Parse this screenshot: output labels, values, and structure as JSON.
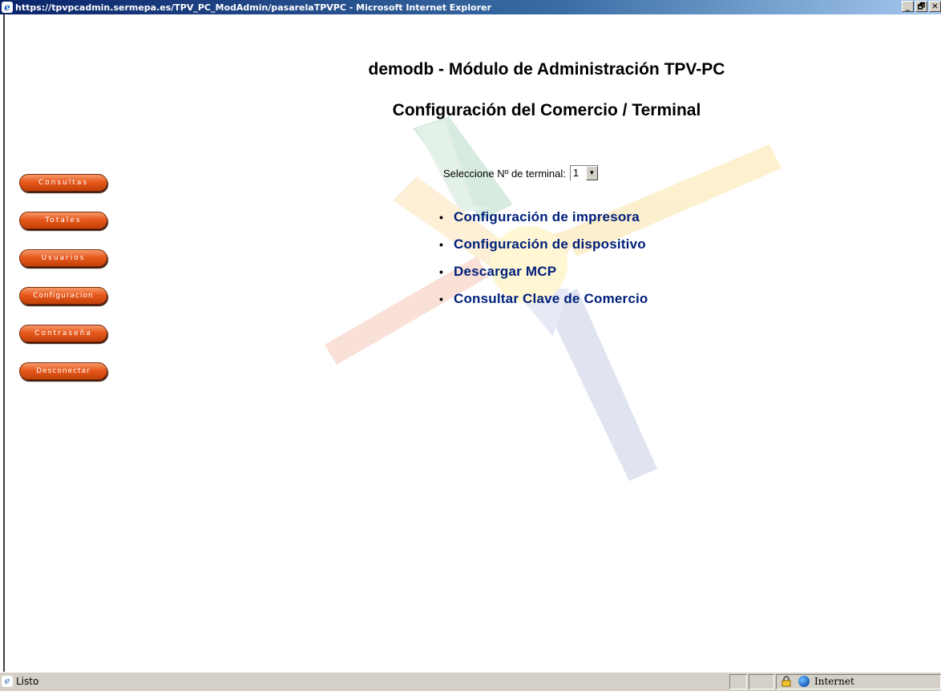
{
  "window": {
    "title": "https://tpvpcadmin.sermepa.es/TPV_PC_ModAdmin/pasarelaTPVPC - Microsoft Internet Explorer",
    "controls": [
      "_",
      "🗗",
      "✕"
    ]
  },
  "page": {
    "heading": "demodb - Módulo de Administración TPV-PC",
    "subheading": "Configuración del Comercio / Terminal"
  },
  "sidebar": {
    "items": [
      {
        "label": "Consultas"
      },
      {
        "label": "Totales"
      },
      {
        "label": "Usuarios"
      },
      {
        "label": "Configuracion"
      },
      {
        "label": "Contraseña"
      },
      {
        "label": "Desconectar"
      }
    ]
  },
  "terminal_select": {
    "label": "Seleccione Nº de terminal:",
    "value": "1"
  },
  "links": [
    {
      "label": "Configuración de impresora"
    },
    {
      "label": "Configuración de dispositivo"
    },
    {
      "label": "Descargar MCP"
    },
    {
      "label": "Consultar Clave de Comercio"
    }
  ],
  "status": {
    "text": "Listo",
    "zone": "Internet"
  },
  "colors": {
    "nav_button": "#e8591d",
    "link": "#00207a",
    "titlebar": "#0a246a"
  }
}
